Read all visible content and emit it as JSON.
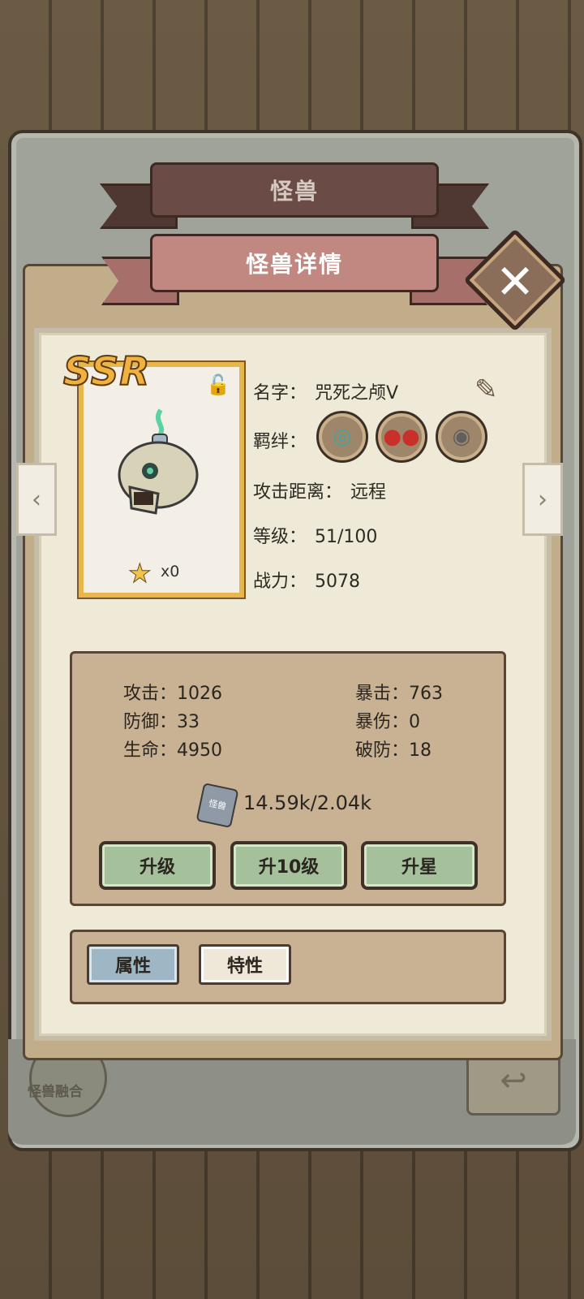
{
  "header": {
    "category_title": "怪兽",
    "detail_title": "怪兽详情"
  },
  "card": {
    "rarity": "SSR",
    "stars": "x0"
  },
  "info": {
    "name_label": "名字：",
    "name_value": "咒死之颅Ⅴ",
    "bond_label": "羁绊：",
    "range_label": "攻击距离：",
    "range_value": "远程",
    "level_label": "等级：",
    "level_value": "51/100",
    "power_label": "战力：",
    "power_value": "5078"
  },
  "stats": {
    "attack": "攻击：1026",
    "defense": "防御：33",
    "hp": "生命：4950",
    "crit": "暴击：763",
    "crit_damage": "暴伤：0",
    "armor_break": "破防：18"
  },
  "exp": {
    "icon_label": "怪兽",
    "value": "14.59k/2.04k"
  },
  "buttons": {
    "upgrade": "升级",
    "upgrade10": "升10级",
    "star_up": "升星"
  },
  "tabs": {
    "attributes": "属性",
    "traits": "特性"
  },
  "footer": {
    "fusion_label": "怪兽融合"
  },
  "colors": {
    "rarity_gold": "#f1b13e",
    "button_green": "#a4c19c",
    "tab_active": "#9fb7c4"
  }
}
